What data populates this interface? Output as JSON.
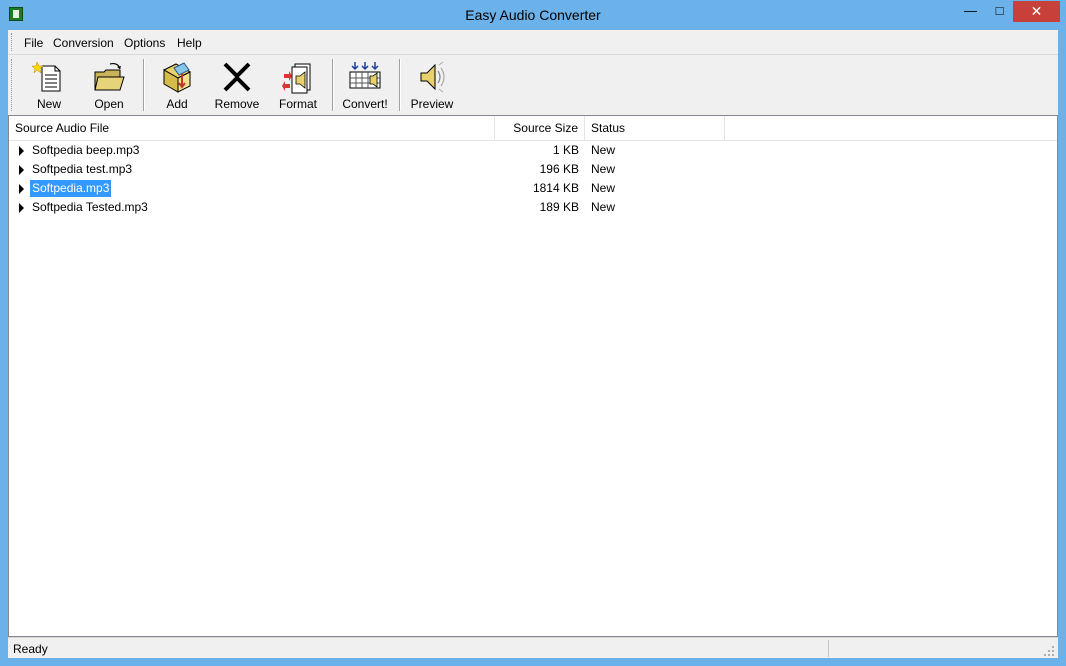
{
  "window": {
    "title": "Easy Audio Converter",
    "minimize": "—",
    "maximize": "□",
    "close": "✕"
  },
  "menu": [
    {
      "label": "File"
    },
    {
      "label": "Conversion"
    },
    {
      "label": "Options"
    },
    {
      "label": "Help"
    }
  ],
  "toolbar": {
    "new": "New",
    "open": "Open",
    "add": "Add",
    "remove": "Remove",
    "format": "Format",
    "convert": "Convert!",
    "preview": "Preview"
  },
  "list": {
    "columns": [
      "Source Audio File",
      "Source Size",
      "Status"
    ],
    "rows": [
      {
        "name": "Softpedia beep.mp3",
        "size": "1 KB",
        "status": "New",
        "selected": false
      },
      {
        "name": "Softpedia test.mp3",
        "size": "196 KB",
        "status": "New",
        "selected": false
      },
      {
        "name": "Softpedia.mp3",
        "size": "1814 KB",
        "status": "New",
        "selected": true
      },
      {
        "name": "Softpedia Tested.mp3",
        "size": "189 KB",
        "status": "New",
        "selected": false
      }
    ]
  },
  "statusbar": {
    "text": "Ready"
  },
  "colors": {
    "titlebar": "#6bb2ea",
    "close_button": "#c7403a",
    "selection": "#3399ff"
  }
}
